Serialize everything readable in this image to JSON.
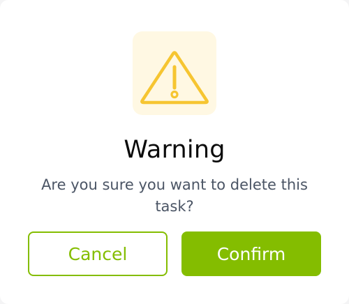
{
  "dialog": {
    "icon": "warning-triangle-icon",
    "title": "Warning",
    "message": "Are you sure you want to delete this task?",
    "cancel_label": "Cancel",
    "confirm_label": "Confirm"
  },
  "colors": {
    "accent": "#84bd00",
    "warning": "#f6c531",
    "warning_bg": "#fff8e3",
    "title": "#0b0b0b",
    "message": "#4b5565"
  }
}
